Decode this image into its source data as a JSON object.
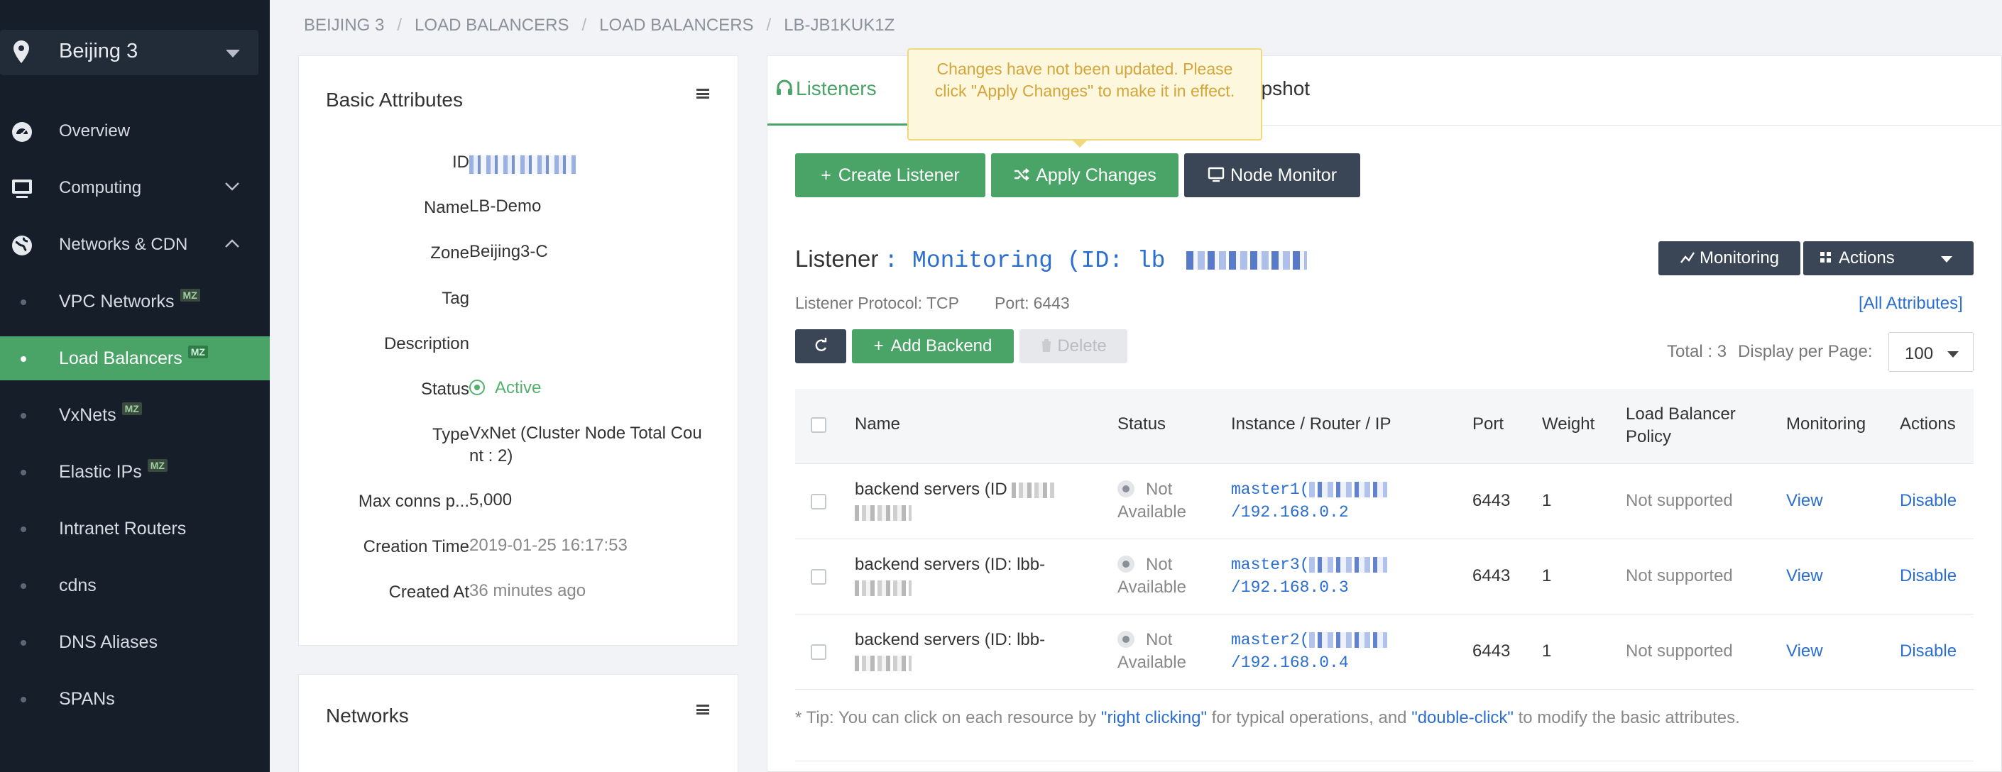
{
  "sidebar": {
    "region": "Beijing 3",
    "items": [
      {
        "label": "Overview",
        "icon": "dashboard-icon"
      },
      {
        "label": "Computing",
        "icon": "monitor-icon",
        "expanded": false
      },
      {
        "label": "Networks & CDN",
        "icon": "globe-icon",
        "expanded": true
      }
    ],
    "subitems": [
      {
        "label": "VPC Networks",
        "badge": "MZ"
      },
      {
        "label": "Load Balancers",
        "badge": "MZ"
      },
      {
        "label": "VxNets",
        "badge": "MZ"
      },
      {
        "label": "Elastic IPs",
        "badge": "MZ"
      },
      {
        "label": "Intranet Routers",
        "badge": ""
      },
      {
        "label": "cdns",
        "badge": ""
      },
      {
        "label": "DNS Aliases",
        "badge": ""
      },
      {
        "label": "SPANs",
        "badge": ""
      }
    ],
    "active_subitem": "Load Balancers",
    "accent_color": "#4aa467"
  },
  "breadcrumb": [
    "BEIJING 3",
    "LOAD BALANCERS",
    "LOAD BALANCERS",
    "LB-JB1KUK1Z"
  ],
  "basic": {
    "title": "Basic Attributes",
    "rows": [
      {
        "key": "ID",
        "value": ""
      },
      {
        "key": "Name",
        "value": "LB-Demo"
      },
      {
        "key": "Zone",
        "value": "Beijing3-C"
      },
      {
        "key": "Tag",
        "value": ""
      },
      {
        "key": "Description",
        "value": ""
      },
      {
        "key": "Status",
        "value": "Active"
      },
      {
        "key": "Type",
        "value": "VxNet (Cluster Node Total Count : 2)"
      },
      {
        "key": "Max conns p...",
        "value": "5,000"
      },
      {
        "key": "Creation Time",
        "value": "2019-01-25 16:17:53"
      },
      {
        "key": "Created At",
        "value": "36 minutes ago"
      }
    ],
    "status_color": "#53b16d"
  },
  "networks": {
    "title": "Networks"
  },
  "tabs": {
    "listeners": "Listeners",
    "snapshot": "apshot"
  },
  "tooltip": "Changes have not been updated. Please click \"Apply Changes\" to make it in effect.",
  "buttons": {
    "create": "Create Listener",
    "apply": "Apply Changes",
    "monitor": "Node Monitor",
    "monitoring": "Monitoring",
    "actions": "Actions",
    "add_backend": "Add Backend",
    "delete": "Delete"
  },
  "listener": {
    "label": "Listener",
    "name": ": Monitoring (ID: lb",
    "protocol_label": "Listener Protocol:",
    "protocol": "TCP",
    "port_label": "Port:",
    "port": "6443",
    "all_attributes": "[All Attributes]"
  },
  "pagination": {
    "total": "Total : 3",
    "display_per_page": "Display per Page:",
    "per_page": "100"
  },
  "table": {
    "headers": [
      "Name",
      "Status",
      "Instance / Router / IP",
      "Port",
      "Weight",
      "Load Balancer Policy",
      "Monitoring",
      "Actions"
    ],
    "rows": [
      {
        "name": "backend servers (ID",
        "status": "Not Available",
        "instance": "master1(",
        "ip": "/192.168.0.2",
        "port": "6443",
        "weight": "1",
        "policy": "Not supported",
        "monitoring": "View",
        "action": "Disable"
      },
      {
        "name": "backend servers (ID: lbb-",
        "status": "Not Available",
        "instance": "master3(",
        "ip": "/192.168.0.3",
        "port": "6443",
        "weight": "1",
        "policy": "Not supported",
        "monitoring": "View",
        "action": "Disable"
      },
      {
        "name": "backend servers (ID: lbb-",
        "status": "Not Available",
        "instance": "master2(",
        "ip": "/192.168.0.4",
        "port": "6443",
        "weight": "1",
        "policy": "Not supported",
        "monitoring": "View",
        "action": "Disable"
      }
    ]
  },
  "tip": {
    "prefix": "* Tip: You can click on each resource by ",
    "rc": "\"right clicking\"",
    "mid": " for typical operations, and ",
    "dc": "\"double-click\"",
    "suffix": " to modify the basic attributes."
  }
}
